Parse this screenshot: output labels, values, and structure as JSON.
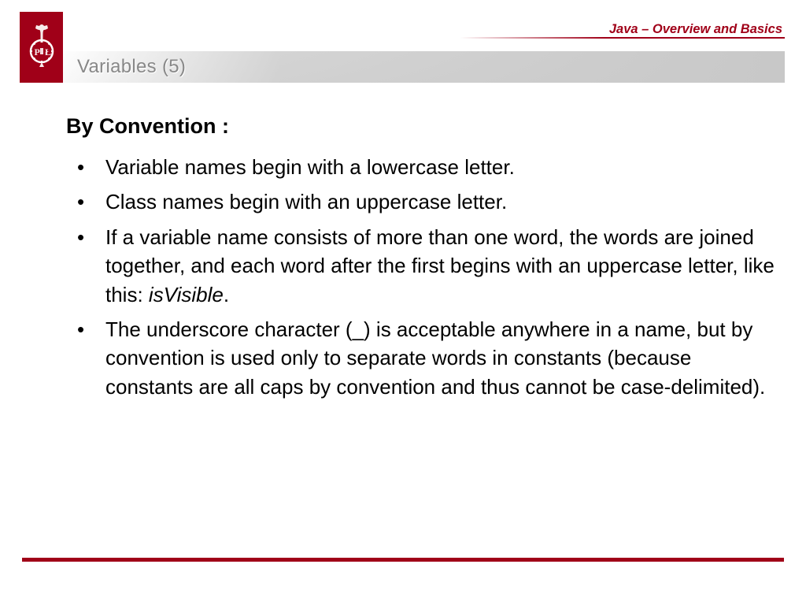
{
  "header": {
    "course_title": "Java – Overview and Basics",
    "slide_title": "Variables (5)"
  },
  "content": {
    "heading": "By Convention :",
    "bullets": [
      {
        "text": "Variable names begin with a lowercase letter."
      },
      {
        "text": "Class names begin with an uppercase letter."
      },
      {
        "text_pre": "If a variable name consists of more than one word, the words are joined together, and each word after the first begins with an uppercase letter, like this: ",
        "italic": "isVisible",
        "text_post": "."
      },
      {
        "text": "The underscore character (_) is acceptable anywhere in a name, but by convention is used only to separate words in constants (because constants are all caps by convention and thus cannot be case-delimited)."
      }
    ]
  }
}
